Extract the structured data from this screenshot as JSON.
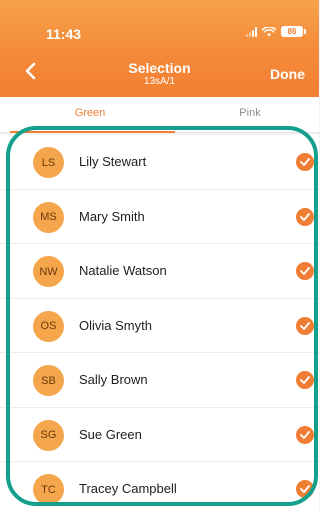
{
  "status_bar": {
    "time": "11:43",
    "battery": "86"
  },
  "nav": {
    "title": "Selection",
    "subtitle": "13sA/1",
    "done_label": "Done"
  },
  "tabs": [
    {
      "label": "Green",
      "active": true
    },
    {
      "label": "Pink",
      "active": false
    }
  ],
  "students": [
    {
      "initials": "LS",
      "name": "Lily Stewart",
      "selected": true
    },
    {
      "initials": "MS",
      "name": "Mary Smith",
      "selected": true
    },
    {
      "initials": "NW",
      "name": "Natalie Watson",
      "selected": true
    },
    {
      "initials": "OS",
      "name": "Olivia Smyth",
      "selected": true
    },
    {
      "initials": "SB",
      "name": "Sally Brown",
      "selected": true
    },
    {
      "initials": "SG",
      "name": "Sue Green",
      "selected": true
    },
    {
      "initials": "TC",
      "name": "Tracey Campbell",
      "selected": true
    }
  ],
  "colors": {
    "accent": "#f07d34",
    "avatar": "#f5a64c",
    "highlight": "#14a08c"
  },
  "icons": {
    "back": "chevron-left-icon",
    "check": "check-circle-icon"
  }
}
